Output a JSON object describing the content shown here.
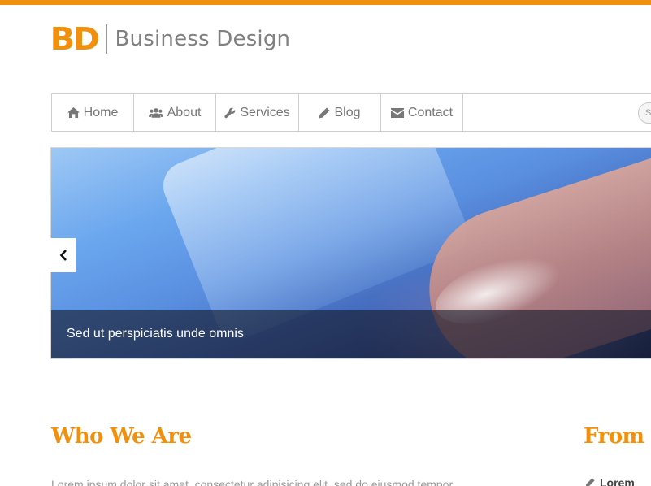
{
  "colors": {
    "accent": "#f0900c",
    "nav_text": "#777777"
  },
  "logo": {
    "mark": "BD",
    "name": "Business Design"
  },
  "nav": {
    "items": [
      {
        "label": "Home",
        "icon": "home-icon"
      },
      {
        "label": "About",
        "icon": "users-icon"
      },
      {
        "label": "Services",
        "icon": "wrench-icon"
      },
      {
        "label": "Blog",
        "icon": "pencil-icon"
      },
      {
        "label": "Contact",
        "icon": "envelope-icon"
      }
    ],
    "search_placeholder": "S"
  },
  "slider": {
    "caption": "Sed ut perspiciatis unde omnis",
    "prev_icon": "chevron-left-icon"
  },
  "sections": {
    "who_title": "Who We Are",
    "who_text": "Lorem ipsum dolor sit amet, consectetur adipisicing elit, sed do eiusmod tempor",
    "from_title": "From T",
    "from_snippet": "Lorem"
  }
}
